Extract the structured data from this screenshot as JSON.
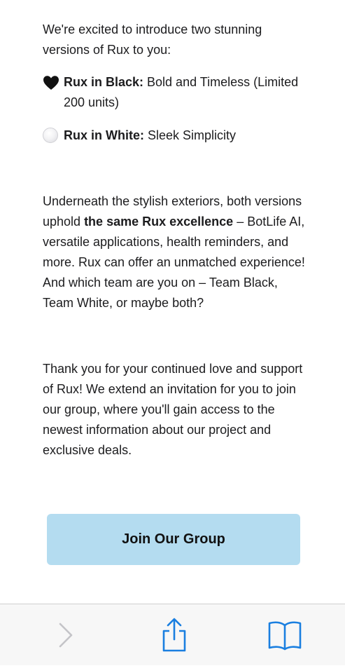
{
  "email": {
    "intro": "We're excited to introduce two stunning versions of Rux to you:",
    "variants": [
      {
        "icon": "black-heart-icon",
        "label": "Rux in Black:",
        "desc": " Bold and Timeless (Limited 200 units)"
      },
      {
        "icon": "white-circle-icon",
        "label": "Rux in White:",
        "desc": " Sleek Simplicity"
      }
    ],
    "para2": {
      "before": "Underneath the stylish exteriors, both versions uphold ",
      "bold": "the same Rux excellence",
      "after": " – BotLife AI, versatile applications, health reminders, and more. Rux can offer an unmatched experience! And which team are you on – Team Black, Team White, or maybe both?"
    },
    "para3": "Thank you for your continued love and support of Rux! We extend an invitation for you to join our group, where you'll gain access to the newest information about our project and exclusive deals.",
    "cta_label": "Join Our Group"
  },
  "toolbar": {
    "items": [
      "forward-chevron-icon",
      "share-icon",
      "bookmarks-icon"
    ],
    "active_color": "#1a7fe0",
    "disabled_color": "#c4c4c8"
  },
  "colors": {
    "cta_background": "#b4dcf0",
    "text": "#1c1c1e"
  }
}
